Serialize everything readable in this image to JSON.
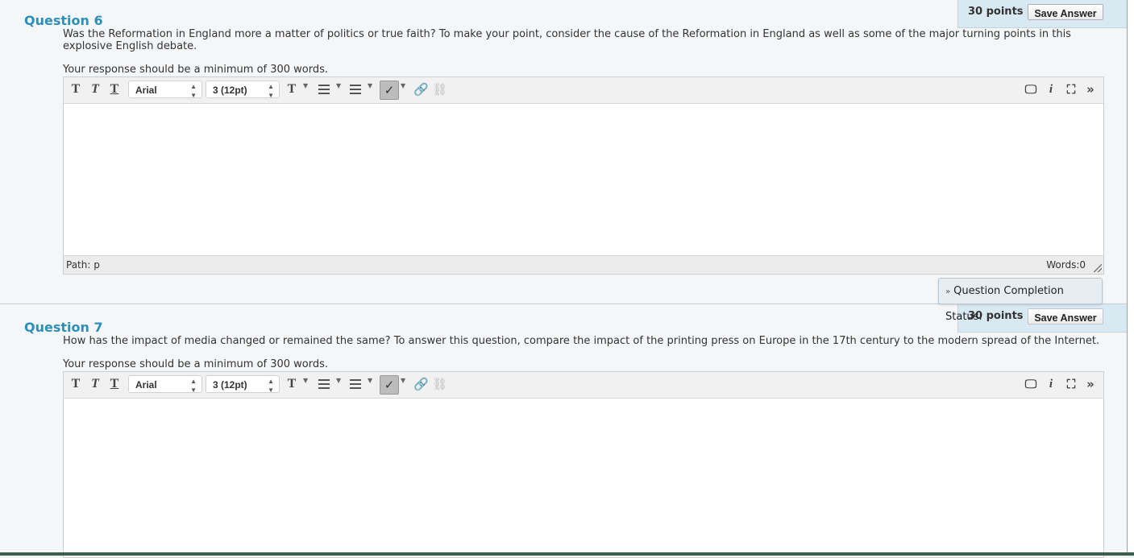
{
  "questions": [
    {
      "title": "Question 6",
      "text": "Was the Reformation in England more a matter of politics or true faith? To make your point, consider the cause of the Reformation in England as well as some of the major turning points in this explosive English debate.",
      "min_words": "Your response should be a minimum of 300 words.",
      "points": "30 points",
      "save_label": "Save Answer",
      "font": "Arial",
      "size": "3 (12pt)",
      "path": "Path: p",
      "words": "Words:0"
    },
    {
      "title": "Question 7",
      "text": "How has the impact of media changed or remained the same? To answer this question, compare the impact of the printing press on Europe in the 17th century to the modern spread of the Internet.",
      "min_words": "Your response should be a minimum of 300 words.",
      "points": "30 points",
      "save_label": "Save Answer",
      "font": "Arial",
      "size": "3 (12pt)"
    }
  ],
  "completion_status": "Question Completion Status:",
  "icons": {
    "bold": "T",
    "italic": "T",
    "underline": "T",
    "text_color": "T",
    "preview": "monitor-icon",
    "info": "i",
    "fullscreen": "expand-icon",
    "more": "chevron-double-down-icon"
  },
  "colors": {
    "title": "#2c8fb8",
    "points_bg": "#d9e9f2"
  }
}
